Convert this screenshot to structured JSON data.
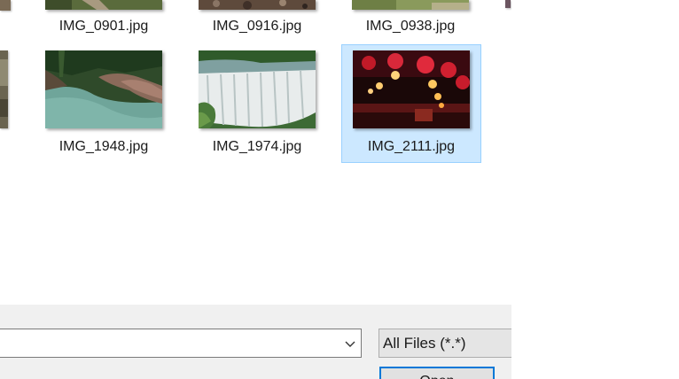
{
  "files": {
    "row1": [
      {
        "name": "IMG_0901.jpg",
        "thumbnail": "road-through-forest-thumbnail"
      },
      {
        "name": "IMG_0916.jpg",
        "thumbnail": "rocky-ground-thumbnail"
      },
      {
        "name": "IMG_0938.jpg",
        "thumbnail": "green-field-thumbnail"
      }
    ],
    "row2": [
      {
        "name": "IMG_1948.jpg",
        "thumbnail": "river-gorge-thumbnail"
      },
      {
        "name": "IMG_1974.jpg",
        "thumbnail": "waterfall-thumbnail"
      },
      {
        "name": "IMG_2111.jpg",
        "thumbnail": "red-lanterns-thumbnail",
        "selected": true
      }
    ]
  },
  "footer": {
    "filename_value": "",
    "file_type_filter": "All Files (*.*)",
    "open_button_label": "Open"
  },
  "colors": {
    "selection_fill": "#cce8ff",
    "selection_border": "#99d1ff",
    "bar_background": "#f0f0f0",
    "button_border": "#0078d7"
  }
}
